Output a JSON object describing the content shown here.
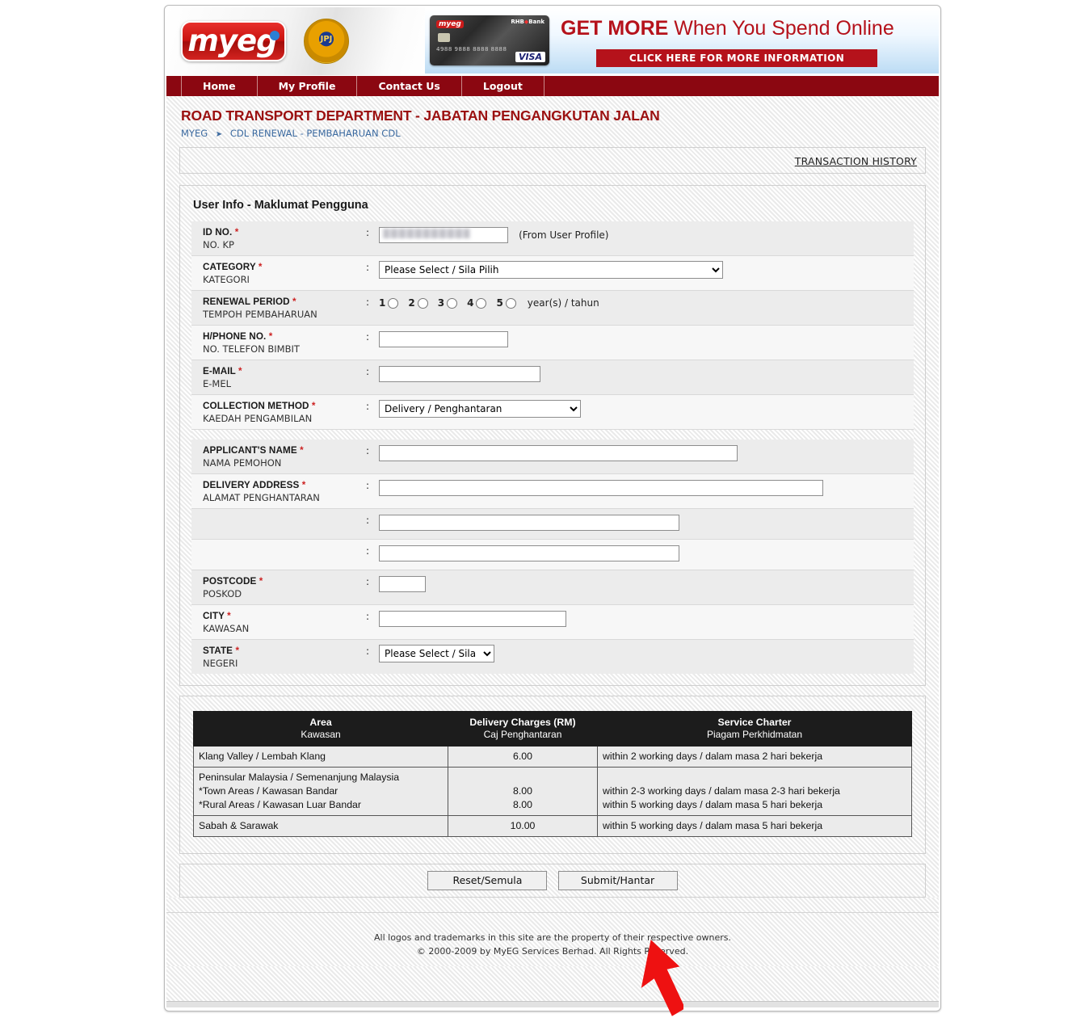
{
  "brand": {
    "logo_text": "myeg",
    "crest_label": "JPJ"
  },
  "ad": {
    "bank_label": "RHB",
    "bank_mark": "◆",
    "bank_suffix": "Bank",
    "card_mini_logo": "myeg",
    "card_number": "4988 9888 8888 8888",
    "card_network": "VISA",
    "headline_bold": "GET MORE",
    "headline_rest": " When You Spend Online",
    "cta_label": "CLICK HERE FOR MORE INFORMATION"
  },
  "nav": {
    "items": [
      {
        "label": "Home"
      },
      {
        "label": "My Profile"
      },
      {
        "label": "Contact Us"
      },
      {
        "label": "Logout"
      }
    ]
  },
  "header": {
    "department_title": "ROAD TRANSPORT DEPARTMENT - JABATAN PENGANGKUTAN JALAN",
    "breadcrumb_root": "MYEG",
    "breadcrumb_sep": "➤",
    "breadcrumb_current": "CDL RENEWAL - PEMBAHARUAN CDL",
    "transaction_history": "TRANSACTION HISTORY"
  },
  "form": {
    "section_title": "User Info - Maklumat Pengguna",
    "colon": ":",
    "required_mark": "*",
    "rows": [
      {
        "en": "ID NO.",
        "ms": "NO. KP",
        "type": "text-blurred",
        "value": "",
        "note": "(From User Profile)"
      },
      {
        "en": "CATEGORY",
        "ms": "KATEGORI",
        "type": "select",
        "value": "Please Select / Sila Pilih"
      },
      {
        "en": "RENEWAL PERIOD",
        "ms": "TEMPOH PEMBAHARUAN",
        "type": "radio",
        "options": [
          "1",
          "2",
          "3",
          "4",
          "5"
        ],
        "unit": "year(s) / tahun",
        "selected": null
      },
      {
        "en": "H/PHONE NO.",
        "ms": "NO. TELEFON BIMBIT",
        "type": "text",
        "value": ""
      },
      {
        "en": "E-MAIL",
        "ms": "E-MEL",
        "type": "text",
        "value": ""
      },
      {
        "en": "COLLECTION METHOD",
        "ms": "KAEDAH PENGAMBILAN",
        "type": "select",
        "value": "Delivery / Penghantaran"
      },
      {
        "en": "APPLICANT'S NAME",
        "ms": "NAMA PEMOHON",
        "type": "text",
        "value": ""
      },
      {
        "en": "DELIVERY ADDRESS",
        "ms": "ALAMAT PENGHANTARAN",
        "type": "text",
        "value": ""
      },
      {
        "en": "",
        "ms": "",
        "type": "text",
        "value": ""
      },
      {
        "en": "",
        "ms": "",
        "type": "text",
        "value": ""
      },
      {
        "en": "POSTCODE",
        "ms": "POSKOD",
        "type": "text",
        "value": ""
      },
      {
        "en": "CITY",
        "ms": "KAWASAN",
        "type": "text",
        "value": ""
      },
      {
        "en": "STATE",
        "ms": "NEGERI",
        "type": "select",
        "value": "Please Select / Sila Pilih"
      }
    ]
  },
  "charges_table": {
    "headers": [
      {
        "en": "Area",
        "ms": "Kawasan"
      },
      {
        "en": "Delivery Charges (RM)",
        "ms": "Caj Penghantaran"
      },
      {
        "en": "Service Charter",
        "ms": "Piagam Perkhidmatan"
      }
    ],
    "rows": [
      {
        "area_lines": [
          "Klang Valley / Lembah Klang"
        ],
        "charge_lines": [
          "6.00"
        ],
        "charter_lines": [
          "within 2 working days / dalam masa 2 hari bekerja"
        ]
      },
      {
        "area_lines": [
          "Peninsular Malaysia / Semenanjung Malaysia",
          "*Town Areas / Kawasan Bandar",
          "*Rural Areas / Kawasan Luar Bandar"
        ],
        "charge_lines": [
          "",
          "8.00",
          "8.00"
        ],
        "charter_lines": [
          "",
          "within 2-3 working days / dalam masa 2-3 hari bekerja",
          "within 5 working days / dalam masa 5 hari bekerja"
        ]
      },
      {
        "area_lines": [
          "Sabah & Sarawak"
        ],
        "charge_lines": [
          "10.00"
        ],
        "charter_lines": [
          "within 5 working days / dalam masa 5 hari bekerja"
        ]
      }
    ]
  },
  "actions": {
    "reset_label": "Reset/Semula",
    "submit_label": "Submit/Hantar"
  },
  "footer": {
    "line1": "All logos and trademarks in this site are the property of their respective owners.",
    "line2": "© 2000-2009 by MyEG Services Berhad. All Rights Reserved."
  },
  "colors": {
    "nav_red": "#8b0711",
    "title_red": "#9b1010",
    "ad_red": "#b5121b",
    "link_blue": "#3c63a8",
    "required_red": "#cc2222",
    "cursor_red": "#ee1111",
    "table_header_black": "#1c1c1c"
  }
}
